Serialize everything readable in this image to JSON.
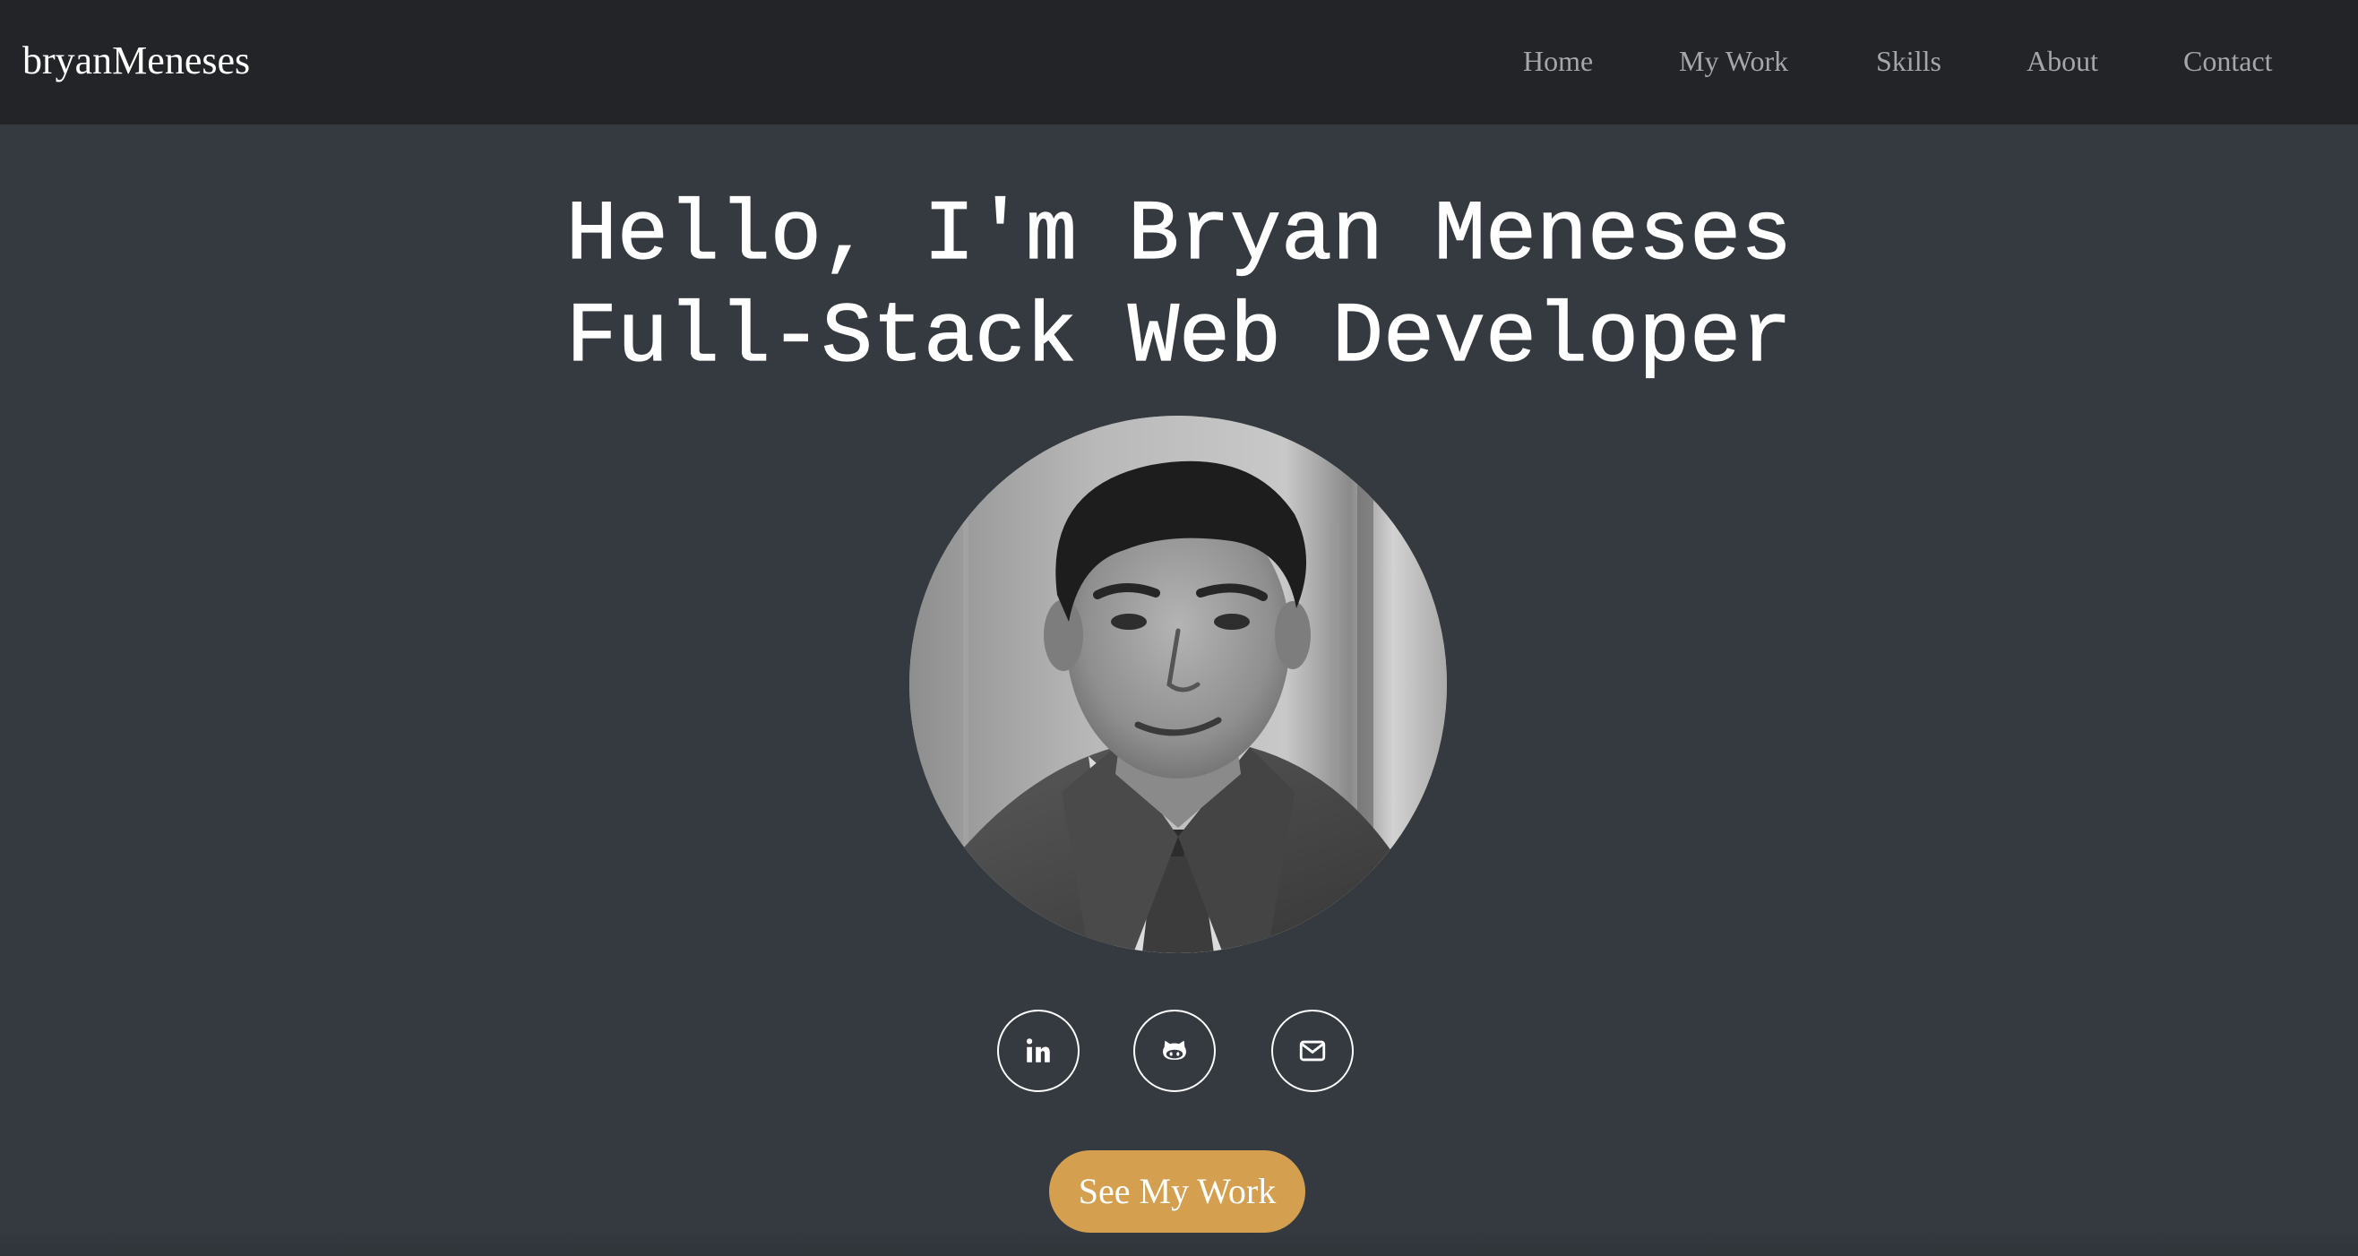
{
  "brand": "bryanMeneses",
  "nav": {
    "items": [
      {
        "label": "Home"
      },
      {
        "label": "My Work"
      },
      {
        "label": "Skills"
      },
      {
        "label": "About"
      },
      {
        "label": "Contact"
      }
    ]
  },
  "hero": {
    "greeting": "Hello, I'm Bryan Meneses",
    "role": "Full-Stack Web Developer"
  },
  "social": [
    {
      "icon": "linkedin-icon"
    },
    {
      "icon": "github-icon"
    },
    {
      "icon": "envelope-icon"
    }
  ],
  "cta": {
    "label": "See My Work"
  },
  "colors": {
    "navbar_bg": "#232427",
    "page_bg": "#343a40",
    "nav_link": "#a3a6aa",
    "cta_bg": "#d4a050",
    "text": "#ffffff"
  }
}
